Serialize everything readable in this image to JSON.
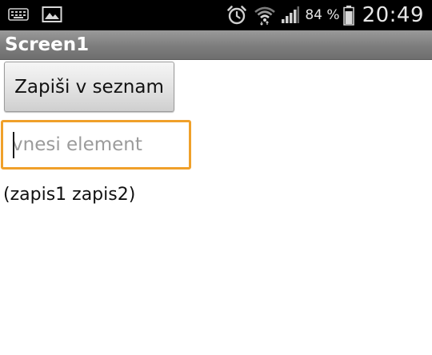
{
  "status_bar": {
    "icons_left": [
      "keyboard-icon",
      "image-icon"
    ],
    "icons_right": [
      "alarm-icon",
      "wifi-icon",
      "signal-icon",
      "battery-icon"
    ],
    "battery_percent": "84 %",
    "battery_level": 84,
    "time": "20:49"
  },
  "title_bar": {
    "title": "Screen1"
  },
  "main": {
    "button_label": "Zapiši v seznam",
    "input_value": "",
    "input_placeholder": "vnesi element",
    "list_label": "(zapis1 zapis2)"
  },
  "colors": {
    "status_bar_bg": "#000000",
    "title_bar_bg": "#7d7d7d",
    "input_focus_border": "#f0a02a",
    "page_bg": "#ffffff"
  }
}
